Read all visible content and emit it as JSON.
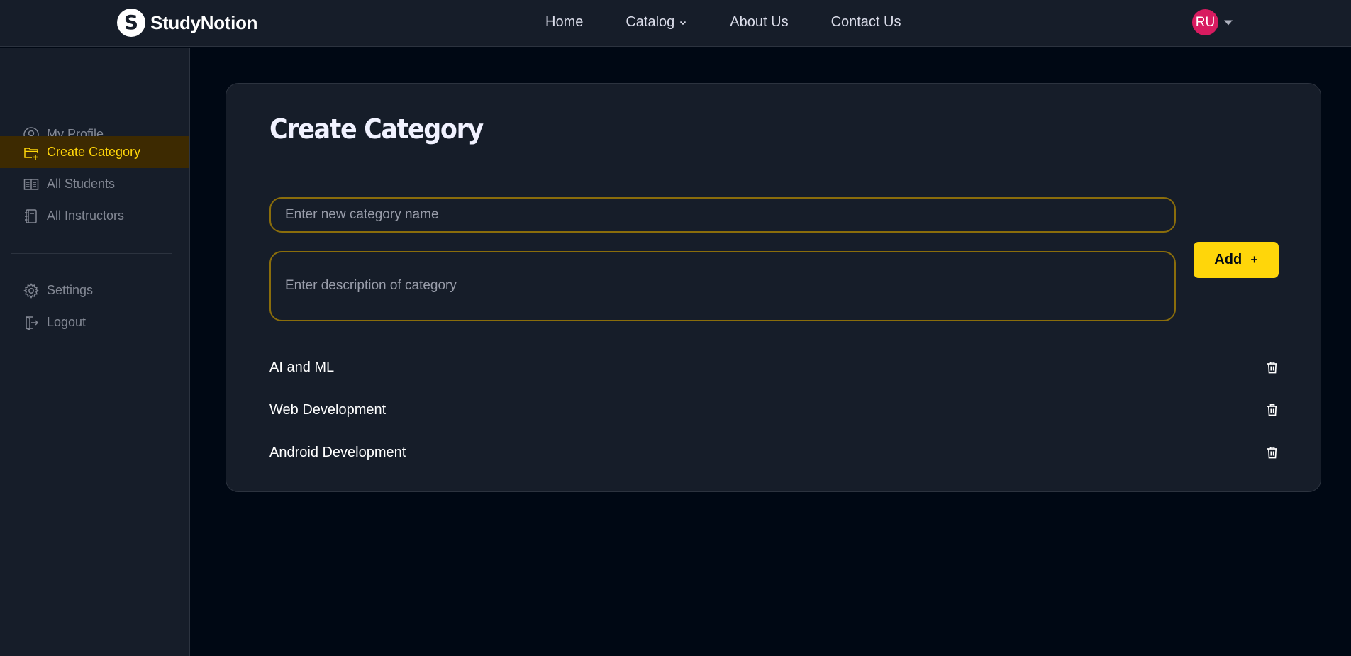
{
  "header": {
    "logo_letter": "S",
    "brand": "StudyNotion",
    "nav": {
      "home": "Home",
      "catalog": "Catalog",
      "about": "About Us",
      "contact": "Contact Us"
    },
    "avatar_initials": "RU"
  },
  "sidebar": {
    "items": [
      {
        "label": "My Profile",
        "icon": "user-circle-icon"
      },
      {
        "label": "Create Category",
        "icon": "folder-plus-icon",
        "active": true
      },
      {
        "label": "All Students",
        "icon": "book-open-icon"
      },
      {
        "label": "All Instructors",
        "icon": "notebook-icon"
      }
    ],
    "bottom_items": [
      {
        "label": "Settings",
        "icon": "gear-icon"
      },
      {
        "label": "Logout",
        "icon": "logout-icon"
      }
    ]
  },
  "main": {
    "title": "Create Category",
    "name_placeholder": "Enter new category name",
    "description_placeholder": "Enter description of category",
    "add_label": "Add",
    "add_symbol": "+",
    "categories": [
      "AI and ML",
      "Web Development",
      "Android Development"
    ]
  },
  "colors": {
    "background": "#000814",
    "panel": "#161d29",
    "accent": "#ffd60a",
    "active_bg": "#3d2a01",
    "avatar": "#d81b60",
    "input_border": "#8a6d0b"
  }
}
